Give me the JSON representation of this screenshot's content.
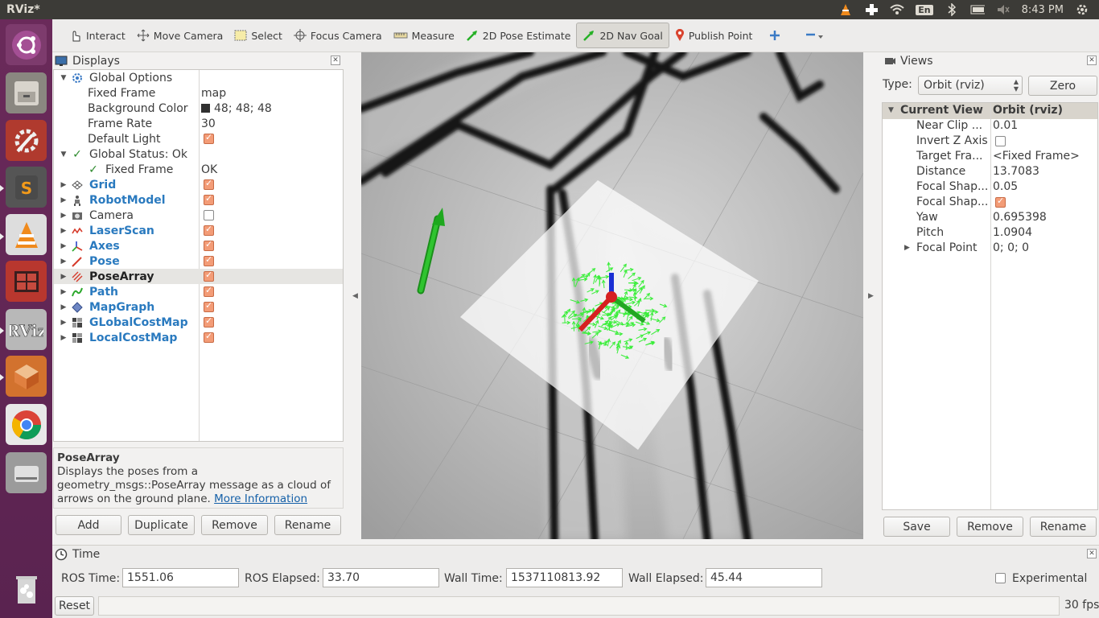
{
  "app": {
    "title": "RViz*"
  },
  "tray": {
    "lang": "En",
    "clock": "8:43 PM"
  },
  "toolbar": {
    "tools": [
      {
        "label": "Interact"
      },
      {
        "label": "Move Camera"
      },
      {
        "label": "Select"
      },
      {
        "label": "Focus Camera"
      },
      {
        "label": "Measure"
      },
      {
        "label": "2D Pose Estimate"
      },
      {
        "label": "2D Nav Goal"
      },
      {
        "label": "Publish Point"
      }
    ],
    "active_tool": "2D Nav Goal"
  },
  "displays": {
    "title": "Displays",
    "rows": [
      {
        "name": "Global Options",
        "value": ""
      },
      {
        "name": "Fixed Frame",
        "value": "map"
      },
      {
        "name": "Background Color",
        "value": "48; 48; 48"
      },
      {
        "name": "Frame Rate",
        "value": "30"
      },
      {
        "name": "Default Light",
        "value": ""
      },
      {
        "name": "Global Status: Ok",
        "value": ""
      },
      {
        "name": "Fixed Frame",
        "value": "OK"
      },
      {
        "name": "Grid",
        "value": ""
      },
      {
        "name": "RobotModel",
        "value": ""
      },
      {
        "name": "Camera",
        "value": ""
      },
      {
        "name": "LaserScan",
        "value": ""
      },
      {
        "name": "Axes",
        "value": ""
      },
      {
        "name": "Pose",
        "value": ""
      },
      {
        "name": "PoseArray",
        "value": ""
      },
      {
        "name": "Path",
        "value": ""
      },
      {
        "name": "MapGraph",
        "value": ""
      },
      {
        "name": "GLobalCostMap",
        "value": ""
      },
      {
        "name": "LocalCostMap",
        "value": ""
      }
    ],
    "selected": "PoseArray",
    "background_color_hex": "#303030"
  },
  "description": {
    "title": "PoseArray",
    "text": "Displays the poses from a geometry_msgs::PoseArray message as a cloud of arrows on the ground plane.",
    "link": "More Information"
  },
  "display_buttons": {
    "add": "Add",
    "duplicate": "Duplicate",
    "remove": "Remove",
    "rename": "Rename"
  },
  "views": {
    "title": "Views",
    "type_label": "Type:",
    "type_value": "Orbit (rviz)",
    "zero": "Zero",
    "header_name": "Current View",
    "header_value": "Orbit (rviz)",
    "rows": [
      {
        "name": "Near Clip ...",
        "value": "0.01"
      },
      {
        "name": "Invert Z Axis",
        "value": ""
      },
      {
        "name": "Target Fra...",
        "value": "<Fixed Frame>"
      },
      {
        "name": "Distance",
        "value": "13.7083"
      },
      {
        "name": "Focal Shap...",
        "value": "0.05"
      },
      {
        "name": "Focal Shap...",
        "value": ""
      },
      {
        "name": "Yaw",
        "value": "0.695398"
      },
      {
        "name": "Pitch",
        "value": "1.0904"
      },
      {
        "name": "Focal Point",
        "value": "0; 0; 0"
      }
    ],
    "buttons": {
      "save": "Save",
      "remove": "Remove",
      "rename": "Rename"
    }
  },
  "time": {
    "title": "Time",
    "ros_time_label": "ROS Time:",
    "ros_time": "1551.06",
    "ros_elapsed_label": "ROS Elapsed:",
    "ros_elapsed": "33.70",
    "wall_time_label": "Wall Time:",
    "wall_time": "1537110813.92",
    "wall_elapsed_label": "Wall Elapsed:",
    "wall_elapsed": "45.44",
    "experimental_label": "Experimental",
    "reset": "Reset",
    "fps": "30 fps"
  }
}
